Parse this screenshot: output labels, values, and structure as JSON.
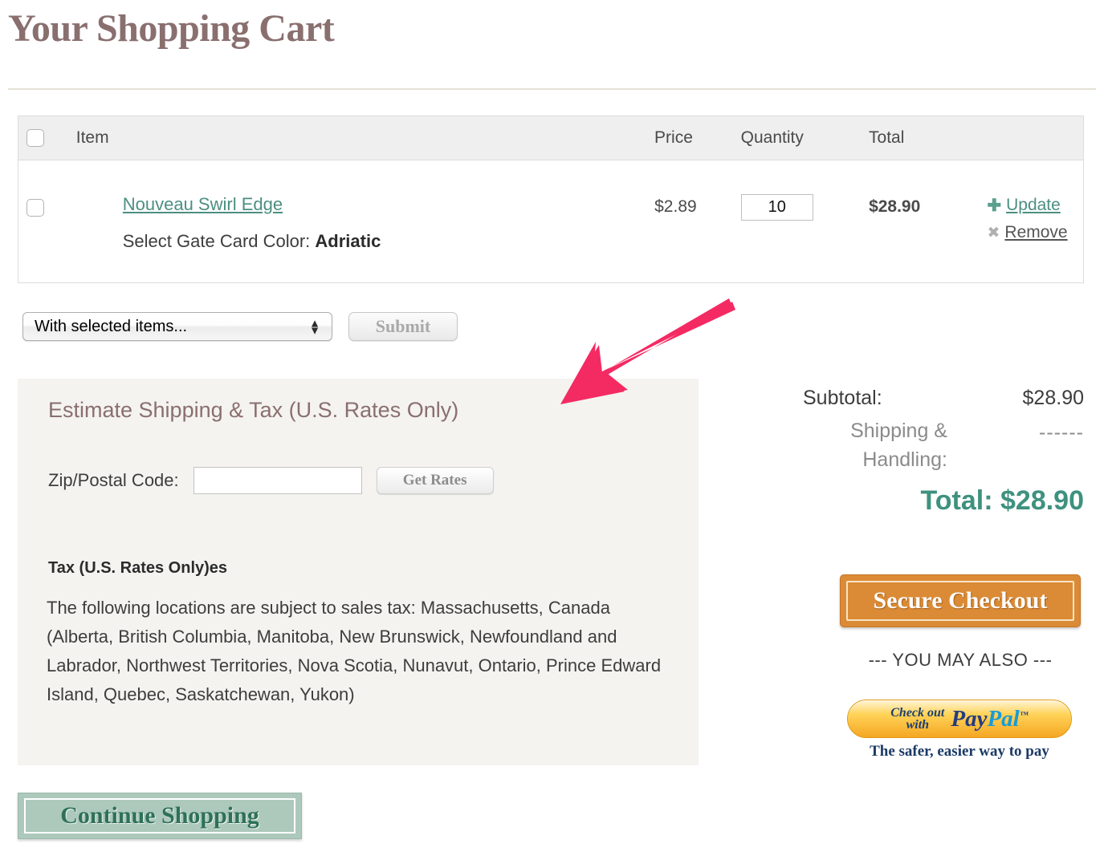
{
  "page": {
    "title": "Your Shopping Cart"
  },
  "cart": {
    "columns": {
      "item": "Item",
      "price": "Price",
      "quantity": "Quantity",
      "total": "Total"
    },
    "rows": [
      {
        "name": "Nouveau Swirl Edge",
        "option_label": "Select Gate Card Color:",
        "option_value": "Adriatic",
        "price": "$2.89",
        "quantity": "10",
        "total": "$28.90",
        "update_label": "Update",
        "remove_label": "Remove"
      }
    ]
  },
  "bulk_actions": {
    "select_value": "With selected items...",
    "submit_label": "Submit"
  },
  "estimate": {
    "title": "Estimate Shipping & Tax (U.S. Rates Only)",
    "zip_label": "Zip/Postal Code:",
    "zip_value": "",
    "zip_placeholder": "",
    "get_rates_label": "Get Rates",
    "tax_heading": "Tax (U.S. Rates Only)es",
    "tax_body": "The following locations are subject to sales tax: Massachusetts, Canada (Alberta, British Columbia, Manitoba, New Brunswick, Newfoundland and Labrador, Northwest Territories, Nova Scotia, Nunavut, Ontario, Prince Edward Island, Quebec, Saskatchewan, Yukon)"
  },
  "summary": {
    "subtotal_label": "Subtotal:",
    "subtotal_value": "$28.90",
    "shipping_label": "Shipping & Handling:",
    "shipping_value": "------",
    "total_line": "Total: $28.90",
    "secure_checkout_label": "Secure Checkout",
    "you_may_also": "--- YOU MAY ALSO ---",
    "paypal_check_line1": "Check out",
    "paypal_check_line2": "with",
    "paypal_pay": "Pay",
    "paypal_pal": "Pal",
    "paypal_tm": "™",
    "paypal_tagline": "The safer, easier way to pay"
  },
  "footer": {
    "continue_shopping_label": "Continue Shopping"
  },
  "annotation": {
    "arrow_color": "#f42a63",
    "arrow_points_to": "Estimate Shipping & Tax (U.S. Rates Only)"
  },
  "colors": {
    "title_mauve": "#8a6f6f",
    "link_teal": "#4c8f81",
    "total_teal": "#3f917f",
    "checkout_orange": "#db8b35",
    "continue_green": "#adc9bb",
    "estimate_bg": "#f4f3ef",
    "table_head_bg": "#efefef"
  }
}
